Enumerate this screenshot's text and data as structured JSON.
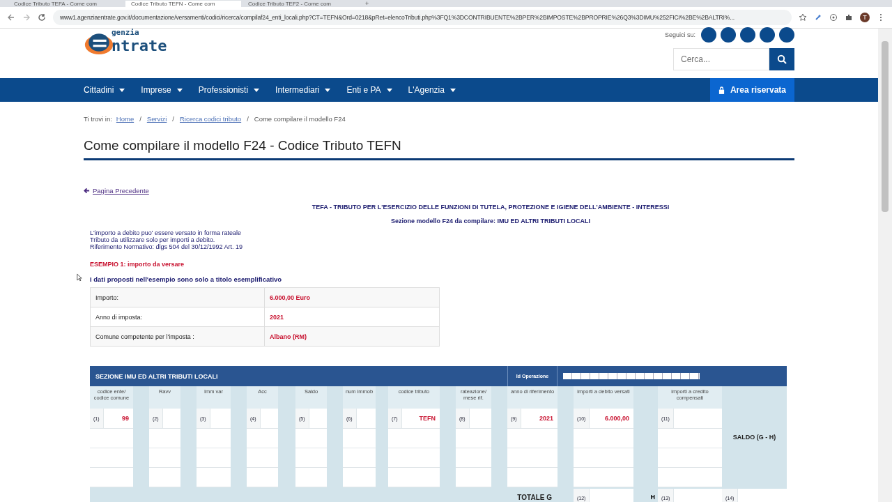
{
  "browser": {
    "tabs": [
      {
        "title": "Codice Tributo TEFA - Come com",
        "selected": false
      },
      {
        "title": "Codice Tributo TEFN - Come com",
        "selected": true
      },
      {
        "title": "Codice Tributo TEF2 - Come com",
        "selected": false
      }
    ],
    "new_tab": "+",
    "url": "www1.agenziaentrate.gov.it/documentazione/versamenti/codici/ricerca/compilaf24_enti_locali.php?CT=TEFN&Ord=0218&pRet=elencoTributi.php%3FQ1%3DCONTRIBUENTE%2BPER%2BIMPOSTE%2BPROPRIE%26Q3%3DIMU%252FICI%2BE%2BALTRI%...",
    "profile": "T"
  },
  "header": {
    "logo_top": "genzia",
    "logo_bottom": "ntrate",
    "follow_label": "Seguici su:",
    "search": {
      "placeholder": "Cerca..."
    }
  },
  "nav": {
    "items": [
      {
        "label": "Cittadini"
      },
      {
        "label": "Imprese"
      },
      {
        "label": "Professionisti"
      },
      {
        "label": "Intermediari"
      },
      {
        "label": "Enti e PA"
      },
      {
        "label": "L'Agenzia"
      }
    ],
    "reserved": "Area riservata"
  },
  "breadcrumb": {
    "prefix": "Ti trovi in:",
    "separator": "/",
    "links": [
      "Home",
      "Servizi",
      "Ricerca codici tributo"
    ],
    "current": "Come compilare il modello F24"
  },
  "title": "Come compilare il modello F24 - Codice Tributo TEFN",
  "back_link": "Pagina Precedente",
  "headings": [
    "TEFA - TRIBUTO PER L'ESERCIZIO DELLE FUNZIONI DI TUTELA, PROTEZIONE E IGIENE DELL'AMBIENTE - INTERESSI",
    "Sezione modello F24 da compilare: IMU ED ALTRI TRIBUTI LOCALI"
  ],
  "notes": [
    "L'importo a debito puo' essere versato in forma rateale",
    "Tributo da utilizzare solo per importi a debito.",
    "Riferimento Normativo: dlgs  504 del 30/12/1992 Art. 19"
  ],
  "example_title": "ESEMPIO 1: importo da versare",
  "disclaimer": "I dati proposti nell'esempio sono solo a titolo esemplificativo",
  "example_table": [
    {
      "label": "Importo:",
      "value": "6.000,00 Euro"
    },
    {
      "label": "Anno di imposta:",
      "value": "2021"
    },
    {
      "label": "Comune competente per l'imposta :",
      "value": "Albano (RM)"
    }
  ],
  "form": {
    "title": "SEZIONE IMU ED ALTRI TRIBUTI LOCALI",
    "id_label": "Id Operazione",
    "columns": [
      {
        "label": "codice ente/ codice comune",
        "number": "(1)",
        "value": "99"
      },
      {
        "label": "Ravv",
        "number": "(2)"
      },
      {
        "label": "Imm var",
        "number": "(3)"
      },
      {
        "label": "Acc",
        "number": "(4)"
      },
      {
        "label": "Saldo",
        "number": "(5)"
      },
      {
        "label": "num immob",
        "number": "(6)"
      },
      {
        "label": "codice tributo",
        "number": "(7)",
        "value": "TEFN"
      },
      {
        "label": "rateazione/ mese rif.",
        "number": "(8)"
      },
      {
        "label": "anno di riferimento",
        "number": "(9)",
        "value": "2021"
      },
      {
        "label": "importi a debito versati",
        "number": "(10)",
        "value": "6.000,00"
      },
      {
        "label": "importi a credito compensati",
        "number": "(11)"
      }
    ],
    "saldo_label": "SALDO (G - H)",
    "totals": {
      "g_label": "TOTALE  G",
      "g_number": "(12)",
      "h_label": "H",
      "h_number": "(13)",
      "saldo_number": "(14)"
    }
  }
}
